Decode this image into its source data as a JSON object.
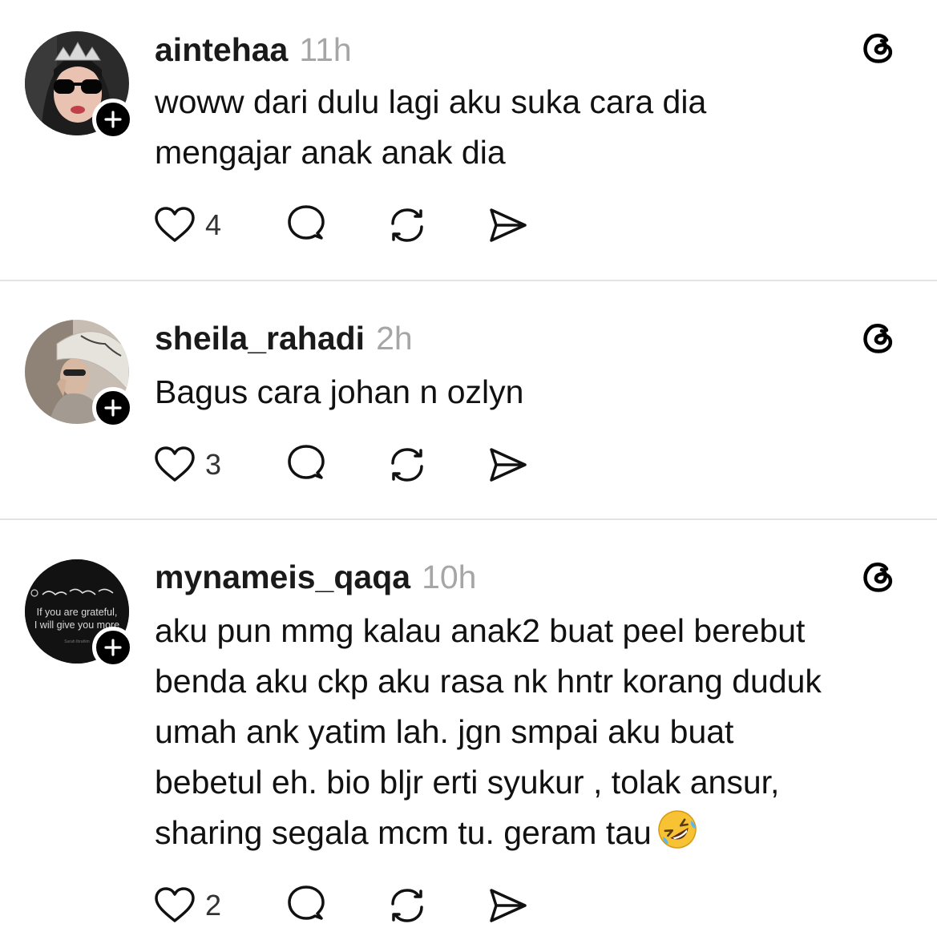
{
  "posts": [
    {
      "username": "aintehaa",
      "time": "11h",
      "lines": [
        "woww dari dulu lagi aku suka cara dia",
        "mengajar anak anak dia"
      ],
      "likes": "4",
      "avatar_icon": "avatar-photo-sunglasses"
    },
    {
      "username": "sheila_rahadi",
      "time": "2h",
      "lines": [
        "Bagus cara johan n ozlyn"
      ],
      "likes": "3",
      "avatar_icon": "avatar-photo-hat"
    },
    {
      "username": "mynameis_qaqa",
      "time": "10h",
      "lines": [
        "aku pun mmg kalau anak2 buat peel berebut",
        "benda aku ckp aku rasa nk hntr korang duduk",
        "umah ank yatim lah. jgn smpai aku buat",
        "bebetul eh. bio bljr erti syukur , tolak ansur,",
        "sharing segala mcm tu. geram tau"
      ],
      "likes": "2",
      "emoji": "rolling-on-floor-laughing-emoji",
      "avatar_icon": "avatar-quote-image",
      "avatar_text": {
        "line1": "If you are grateful,",
        "line2": "I will give you more"
      }
    }
  ],
  "colors": {
    "text": "#111111",
    "muted": "#a6a6a6",
    "divider": "#e3e3e3",
    "badge": "#000000"
  }
}
